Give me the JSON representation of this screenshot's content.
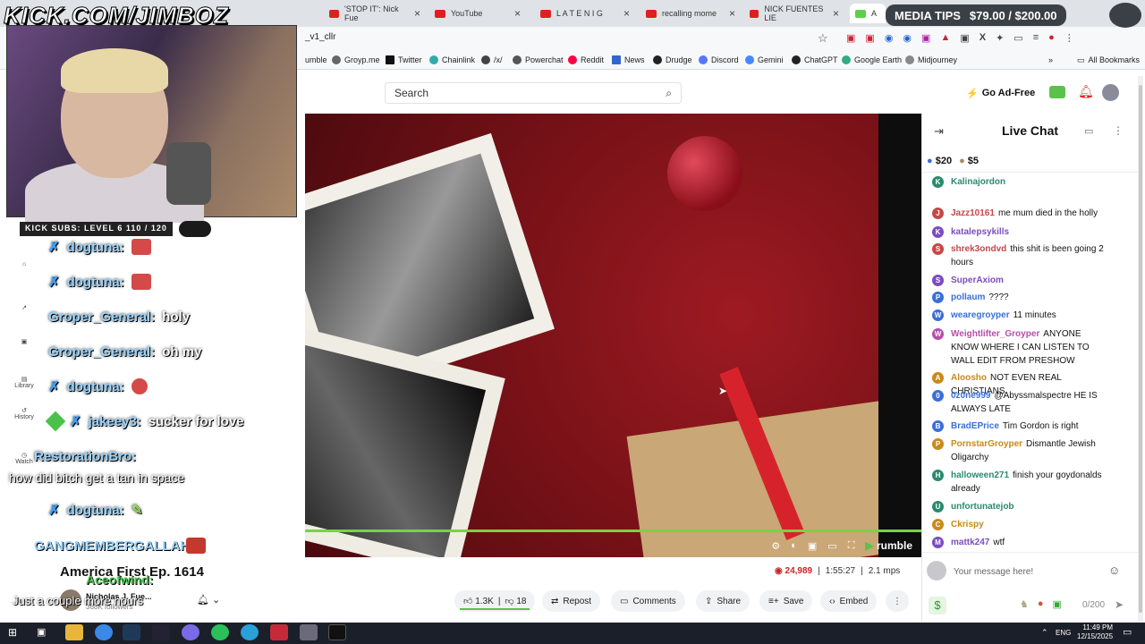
{
  "browser": {
    "tabs": [
      {
        "label": "'STOP IT': Nick Fue"
      },
      {
        "label": "YouTube"
      },
      {
        "label": "L A T E   N I G"
      },
      {
        "label": "recalling mome"
      },
      {
        "label": "NICK FUENTES LIE"
      },
      {
        "label": "A"
      }
    ],
    "url": "_v1_cllr",
    "bookmarks": [
      "umble",
      "Groyp.me",
      "Twitter",
      "Chainlink",
      "/x/",
      "Powerchat",
      "Reddit",
      "News",
      "Drudge",
      "Discord",
      "Gemini",
      "ChatGPT",
      "Google Earth",
      "Midjourney"
    ],
    "all_bookmarks": "All Bookmarks"
  },
  "site": {
    "search_placeholder": "Search",
    "go_ad_free": "Go Ad-Free"
  },
  "sidebar": {
    "items": [
      "Watch",
      "History",
      "Library"
    ]
  },
  "overlay": {
    "stream_url": "KICK.COM/JIMBOZ",
    "subs_bar": "KICK SUBS: LEVEL 6 110 / 120",
    "media_tips": "MEDIA TIPS",
    "media_amount": "$79.00 / $200.00",
    "chat": [
      {
        "user": "dogtuna:",
        "text": ""
      },
      {
        "user": "dogtuna:",
        "text": ""
      },
      {
        "user": "Groper_General:",
        "text": "holy"
      },
      {
        "user": "Groper_General:",
        "text": "oh my"
      },
      {
        "user": "dogtuna:",
        "text": ""
      },
      {
        "user": "jakeey3:",
        "text": "sucker for love"
      },
      {
        "user": "RestorationBro:",
        "text": ""
      },
      {
        "user": "",
        "text": "how did bitch get a tan in space"
      },
      {
        "user": "dogtuna:",
        "text": ""
      }
    ],
    "gangmember": "GANGMEMBERGALLAH:",
    "aceofwind": "Aceofwind:",
    "just_a_couple": "Just a couple more hours"
  },
  "video": {
    "title": "America First Ep. 1614",
    "channel": "Nicholas J. Fue...",
    "followers": "368K followers",
    "views": "24,989",
    "duration": "1:55:27",
    "mps": "2.1 mps",
    "brand": "rumble",
    "progress_fraction": 1.0,
    "actions": {
      "likes": "1.3K",
      "dislikes": "18",
      "repost": "Repost",
      "comments": "Comments",
      "share": "Share",
      "save": "Save",
      "embed": "Embed"
    }
  },
  "chat_panel": {
    "title": "Live Chat",
    "tips": [
      "$20",
      "$5"
    ],
    "messages": [
      {
        "user": "Kalinajordon",
        "text": "",
        "color": "#2b8a6e"
      },
      {
        "user": "Jazz10161",
        "text": "me mum died in the holly",
        "color": "#c54848"
      },
      {
        "user": "katalepsykills",
        "text": "",
        "color": "#7b4cc0"
      },
      {
        "user": "shrek3ondvd",
        "text": "this shit is been going 2 hours",
        "color": "#c54848"
      },
      {
        "user": "SuperAxiom",
        "text": "",
        "color": "#7b4cc0"
      },
      {
        "user": "pollaum",
        "text": "????",
        "color": "#3a6fd8"
      },
      {
        "user": "wearegroyper",
        "text": "11 minutes",
        "color": "#3a6fd8"
      },
      {
        "user": "Weightlifter_Groyper",
        "text": "ANYONE KNOW WHERE I CAN LISTEN TO WALL EDIT FROM PRESHOW",
        "color": "#b84caa"
      },
      {
        "user": "Aloosho",
        "text": "NOT EVEN REAL CHRISTIANS",
        "color": "#c88a1a"
      },
      {
        "user": "0z0ne999",
        "text": "@Abyssmalspectre HE IS ALWAYS LATE",
        "color": "#3a6fd8"
      },
      {
        "user": "BradEPrice",
        "text": "Tim Gordon is right",
        "color": "#3a6fd8"
      },
      {
        "user": "PornstarGroyper",
        "text": "Dismantle Jewish Oligarchy",
        "color": "#c88a1a"
      },
      {
        "user": "halloween271",
        "text": "finish your goydonalds already",
        "color": "#2b8a6e"
      },
      {
        "user": "unfortunatejob",
        "text": "",
        "color": "#2b8a6e"
      },
      {
        "user": "Ckrispy",
        "text": "",
        "color": "#c88a1a"
      },
      {
        "user": "mattk247",
        "text": "wtf",
        "color": "#7b4cc0"
      }
    ],
    "input_placeholder": "Your message here!",
    "counter": "0/200"
  },
  "taskbar": {
    "lang": "ENG",
    "time": "11:49 PM",
    "date": "12/15/2025"
  }
}
